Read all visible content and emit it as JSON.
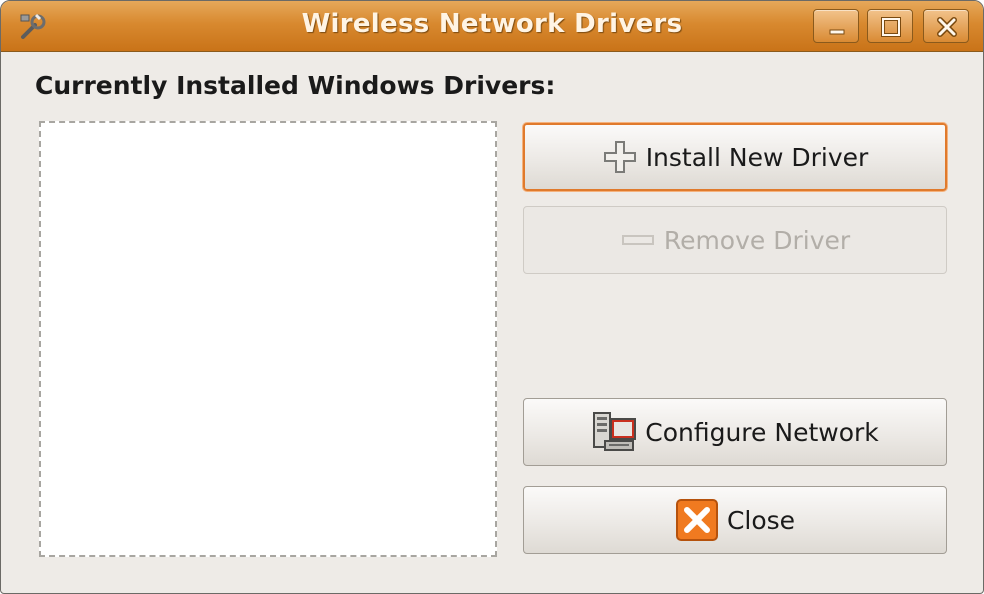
{
  "window": {
    "title": "Wireless Network Drivers",
    "app_icon": "wrench-network-icon",
    "controls": {
      "minimize_icon": "minimize-icon",
      "maximize_icon": "maximize-icon",
      "close_icon": "close-icon"
    }
  },
  "main": {
    "heading": "Currently Installed Windows Drivers:",
    "driver_list": []
  },
  "buttons": {
    "install": {
      "label": "Install New Driver",
      "icon": "plus-icon",
      "enabled": true
    },
    "remove": {
      "label": "Remove Driver",
      "icon": "minus-icon",
      "enabled": false
    },
    "configure": {
      "label": "Configure Network",
      "icon": "network-config-icon",
      "enabled": true
    },
    "close": {
      "label": "Close",
      "icon": "close-x-icon",
      "enabled": true
    }
  },
  "colors": {
    "titlebar": "#d8892f",
    "focus_border": "#e07a2c",
    "close_icon_bg": "#f07a20"
  }
}
